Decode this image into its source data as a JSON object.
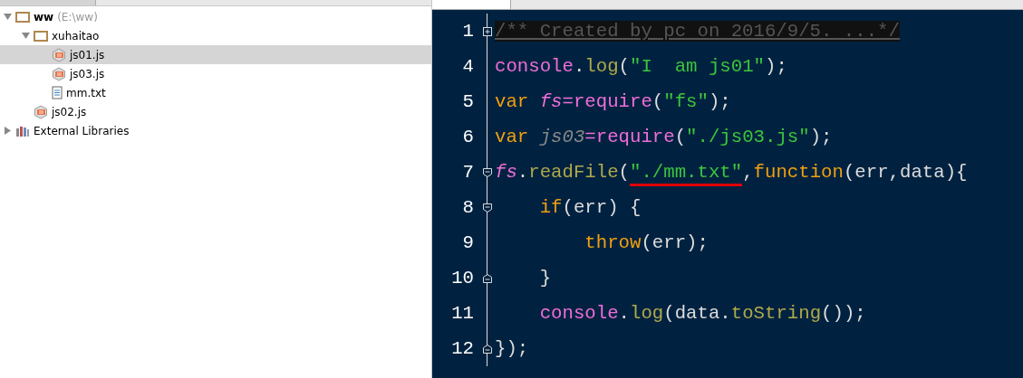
{
  "project_tree": [
    {
      "kind": "folder",
      "label": "ww",
      "path": "(E:\\ww)",
      "expanded": true,
      "selected": false,
      "children": [
        {
          "kind": "folder",
          "label": "xuhaitao",
          "expanded": true,
          "selected": false,
          "children": [
            {
              "kind": "js",
              "label": "js01.js",
              "selected": true
            },
            {
              "kind": "js",
              "label": "js03.js",
              "selected": false
            },
            {
              "kind": "txt",
              "label": "mm.txt",
              "selected": false
            }
          ]
        },
        {
          "kind": "js",
          "label": "js02.js",
          "selected": false
        }
      ]
    },
    {
      "kind": "library",
      "label": "External Libraries",
      "expanded": false,
      "selected": false
    }
  ],
  "editor": {
    "lines": [
      {
        "number": "1",
        "folded": true,
        "fold_start": false,
        "fold_end": false,
        "tokens": [
          {
            "kind": "folded",
            "text": "/** Created by pc on 2016/9/5. ...*/"
          }
        ]
      },
      {
        "number": "4",
        "folded": false,
        "fold_start": false,
        "fold_end": false,
        "tokens": [
          {
            "kind": "object",
            "text": "console"
          },
          {
            "kind": "plain",
            "text": "."
          },
          {
            "kind": "method",
            "text": "log"
          },
          {
            "kind": "plain",
            "text": "("
          },
          {
            "kind": "string",
            "text": "\"I  am js01\""
          },
          {
            "kind": "plain",
            "text": ");"
          }
        ]
      },
      {
        "number": "5",
        "folded": false,
        "fold_start": false,
        "fold_end": false,
        "tokens": [
          {
            "kind": "keyword",
            "text": "var "
          },
          {
            "kind": "variable",
            "text": "fs"
          },
          {
            "kind": "object",
            "text": "=require"
          },
          {
            "kind": "plain",
            "text": "("
          },
          {
            "kind": "string",
            "text": "\"fs\""
          },
          {
            "kind": "plain",
            "text": ");"
          }
        ]
      },
      {
        "number": "6",
        "folded": false,
        "fold_start": false,
        "fold_end": false,
        "tokens": [
          {
            "kind": "keyword",
            "text": "var "
          },
          {
            "kind": "unused",
            "text": "js03"
          },
          {
            "kind": "object",
            "text": "=require"
          },
          {
            "kind": "plain",
            "text": "("
          },
          {
            "kind": "string",
            "text": "\"./js03.js\""
          },
          {
            "kind": "plain",
            "text": ");"
          }
        ]
      },
      {
        "number": "7",
        "folded": false,
        "fold_start": true,
        "fold_end": false,
        "tokens": [
          {
            "kind": "variable",
            "text": "fs"
          },
          {
            "kind": "plain",
            "text": "."
          },
          {
            "kind": "method",
            "text": "readFile"
          },
          {
            "kind": "plain",
            "text": "("
          },
          {
            "kind": "string",
            "text": "\"./mm.txt\"",
            "underlined": true
          },
          {
            "kind": "plain",
            "text": ","
          },
          {
            "kind": "keyword",
            "text": "function"
          },
          {
            "kind": "plain",
            "text": "(err,data){"
          }
        ]
      },
      {
        "number": "8",
        "folded": false,
        "fold_start": true,
        "fold_end": false,
        "tokens": [
          {
            "kind": "keyword",
            "text": "    if"
          },
          {
            "kind": "plain",
            "text": "(err) {"
          }
        ]
      },
      {
        "number": "9",
        "folded": false,
        "fold_start": false,
        "fold_end": false,
        "tokens": [
          {
            "kind": "keyword",
            "text": "        throw"
          },
          {
            "kind": "plain",
            "text": "(err);"
          }
        ]
      },
      {
        "number": "10",
        "folded": false,
        "fold_start": false,
        "fold_end": true,
        "tokens": [
          {
            "kind": "plain",
            "text": "    }"
          }
        ]
      },
      {
        "number": "11",
        "folded": false,
        "fold_start": false,
        "fold_end": false,
        "tokens": [
          {
            "kind": "object",
            "text": "    console"
          },
          {
            "kind": "plain",
            "text": "."
          },
          {
            "kind": "method",
            "text": "log"
          },
          {
            "kind": "plain",
            "text": "(data."
          },
          {
            "kind": "method",
            "text": "toString"
          },
          {
            "kind": "plain",
            "text": "());"
          }
        ]
      },
      {
        "number": "12",
        "folded": false,
        "fold_start": false,
        "fold_end": true,
        "tokens": [
          {
            "kind": "plain",
            "text": "});"
          }
        ]
      }
    ]
  }
}
